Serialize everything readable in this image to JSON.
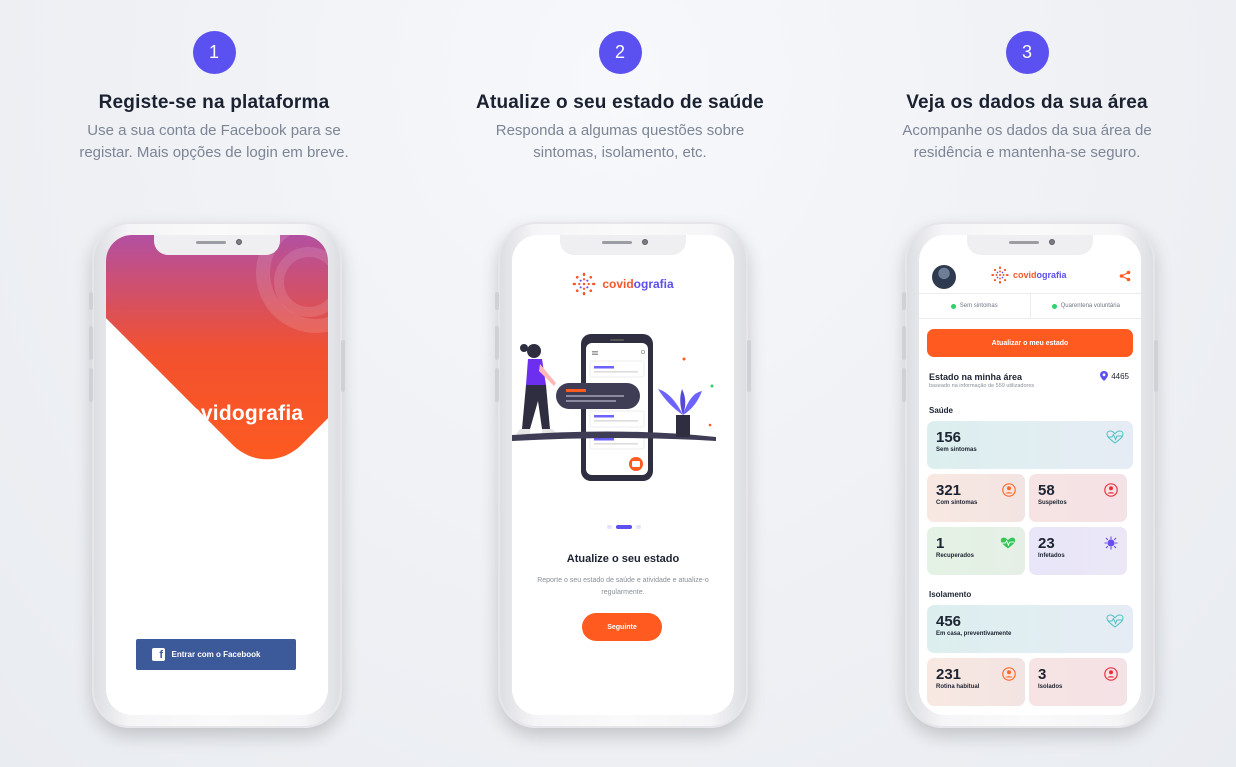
{
  "steps": [
    {
      "number": "1",
      "title": "Registe-se na plataforma",
      "description": "Use a sua conta de Facebook para se registar. Mais opções de login em breve."
    },
    {
      "number": "2",
      "title": "Atualize o seu estado de saúde",
      "description": "Responda a algumas questões sobre sintomas, isolamento, etc."
    },
    {
      "number": "3",
      "title": "Veja os dados da sua área",
      "description": "Acompanhe os dados da sua área de residência e mantenha-se seguro."
    }
  ],
  "phone1": {
    "brand": "covidografia",
    "facebook_button": "Entrar com o Facebook"
  },
  "phone2": {
    "brand_prefix": "covid",
    "brand_suffix": "ografia",
    "title": "Atualize o seu estado",
    "description": "Reporte o seu estado de saúde e atividade e atualize-o regularmente.",
    "button": "Seguinte"
  },
  "phone3": {
    "brand_prefix": "covid",
    "brand_suffix": "ografia",
    "status_left": "Sem sintomas",
    "status_right": "Quarentena voluntária",
    "update_button": "Atualizar o meu estado",
    "area_title": "Estado na minha área",
    "area_subtitle": "baseado na informação de 559 utilizadores",
    "area_count": "4465",
    "health_section": "Saúde",
    "isolation_section": "Isolamento",
    "health": {
      "no_symptoms": {
        "value": "156",
        "label": "Sem sintomas"
      },
      "with_symptoms": {
        "value": "321",
        "label": "Com sintomas"
      },
      "suspects": {
        "value": "58",
        "label": "Suspeitos"
      },
      "recovered": {
        "value": "1",
        "label": "Recuperados"
      },
      "infected": {
        "value": "23",
        "label": "Infetados"
      }
    },
    "isolation": {
      "at_home": {
        "value": "456",
        "label": "Em casa, preventivamente"
      },
      "routine": {
        "value": "231",
        "label": "Rotina habitual"
      },
      "isolated": {
        "value": "3",
        "label": "Isolados"
      }
    }
  },
  "colors": {
    "accent_purple": "#5b50f0",
    "accent_orange": "#ff5a1f",
    "facebook_blue": "#3c5a9a"
  }
}
